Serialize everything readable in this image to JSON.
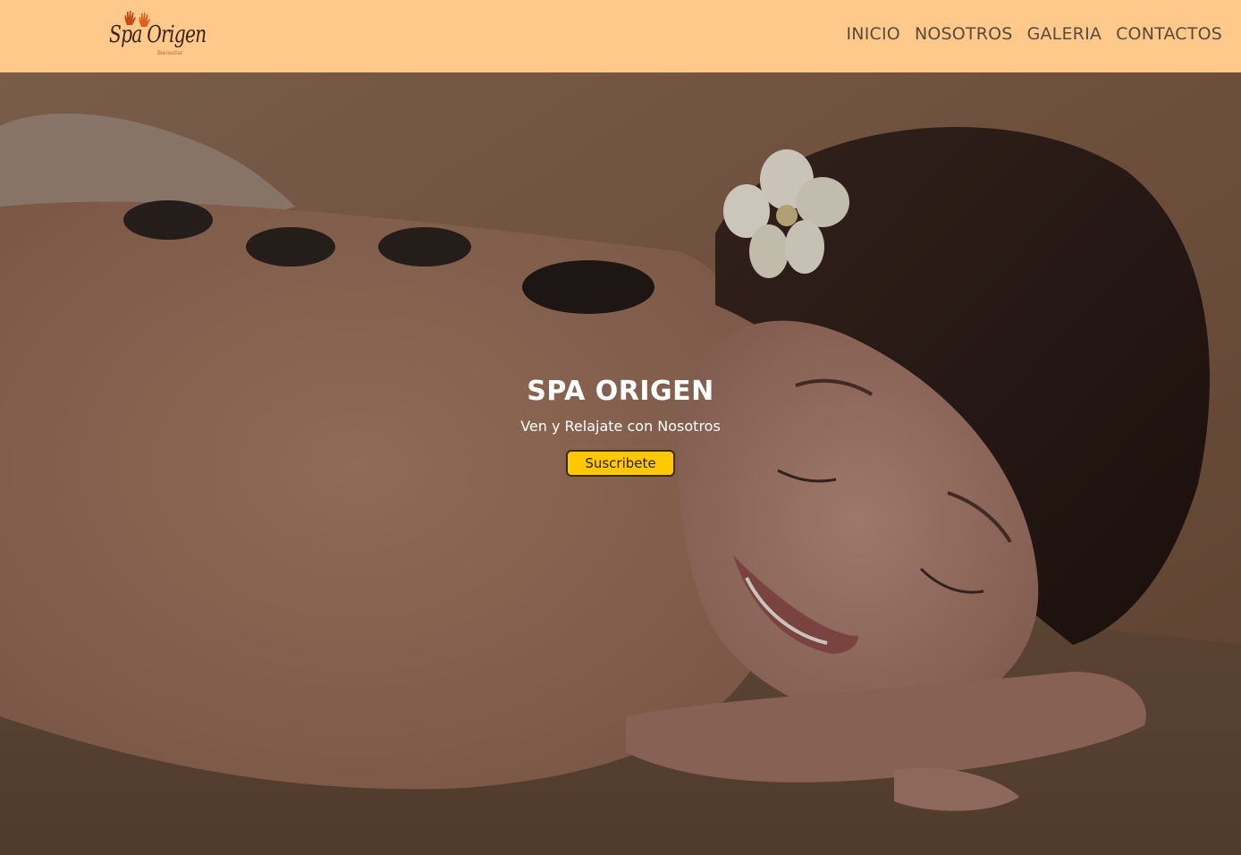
{
  "header": {
    "logo_text": "Spa Origen",
    "logo_sub": "Bienestar"
  },
  "nav": {
    "items": [
      {
        "label": "INICIO"
      },
      {
        "label": "NOSOTROS"
      },
      {
        "label": "GALERIA"
      },
      {
        "label": "CONTACTOS"
      }
    ]
  },
  "hero": {
    "title": "SPA ORIGEN",
    "subtitle": "Ven y Relajate con Nosotros",
    "button_label": "Suscribete"
  },
  "colors": {
    "header_bg": "#ffc98c",
    "button_bg": "#ffc800",
    "nav_text": "#5a4a3c"
  }
}
